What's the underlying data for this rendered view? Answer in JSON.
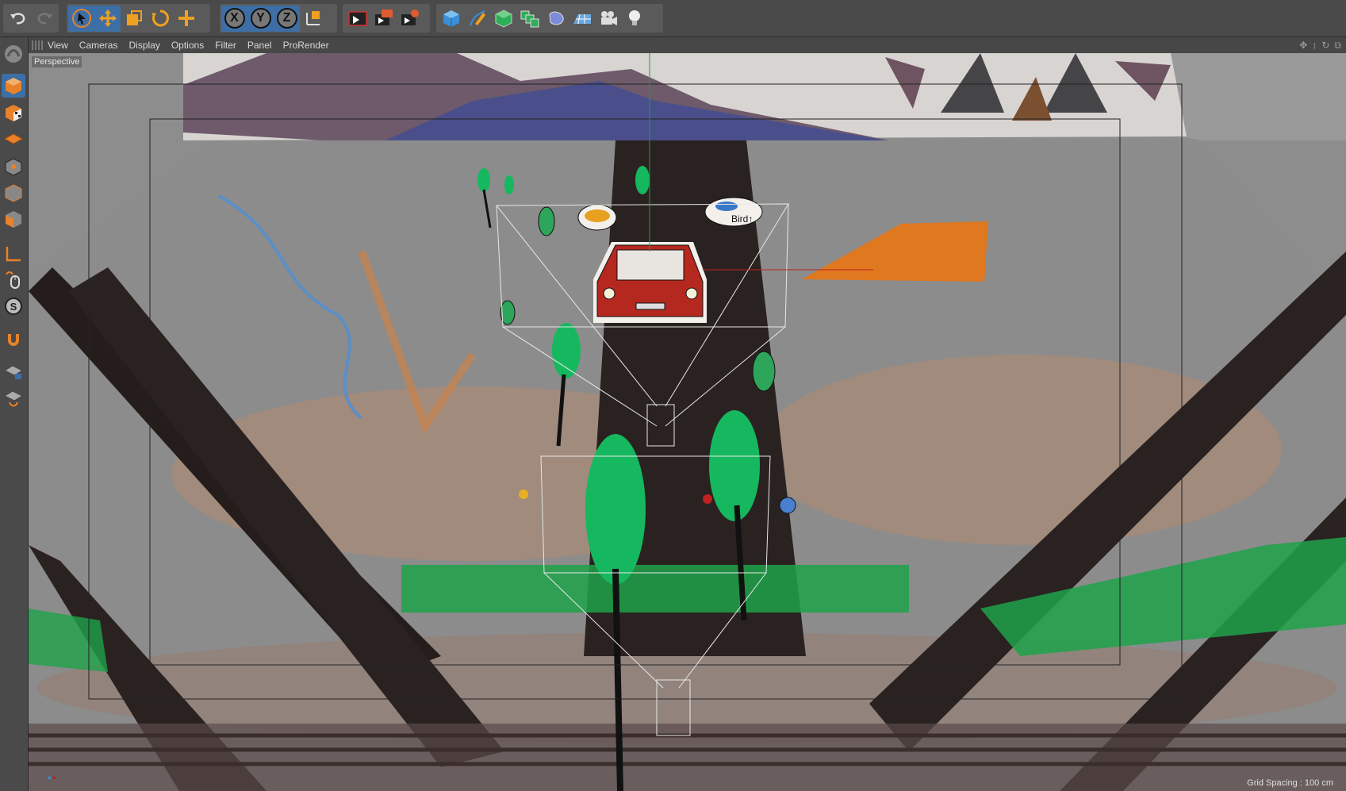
{
  "toolbar": {
    "groups": [
      {
        "name": "history",
        "items": [
          "undo-icon",
          "redo-icon"
        ]
      },
      {
        "name": "tools",
        "items": [
          "select-arrow-icon",
          "move-icon",
          "scale-icon",
          "rotate-icon",
          "last-tool-icon"
        ]
      },
      {
        "name": "axis-lock",
        "items": [
          "X",
          "Y",
          "Z",
          "coordinate-system-icon"
        ]
      },
      {
        "name": "render",
        "items": [
          "render-view-icon",
          "render-picture-viewer-icon",
          "render-settings-icon"
        ]
      },
      {
        "name": "objects",
        "items": [
          "cube-icon",
          "pen-spline-icon",
          "subdivision-icon",
          "array-icon",
          "deformer-icon",
          "floor-icon",
          "camera-icon",
          "light-icon"
        ]
      }
    ],
    "axis_labels": {
      "x": "X",
      "y": "Y",
      "z": "Z"
    }
  },
  "left_palette": {
    "items": [
      "make-editable-icon",
      "model-mode-icon",
      "texture-mode-icon",
      "workplane-icon",
      "points-mode-icon",
      "edges-mode-icon",
      "polygons-mode-icon",
      "axis-mode-icon",
      "tweak-mode-icon",
      "solo-icon",
      "snap-icon",
      "workplane-lock-icon",
      "workplane-snap-icon"
    ]
  },
  "viewport_menu": {
    "items": [
      "View",
      "Cameras",
      "Display",
      "Options",
      "Filter",
      "Panel",
      "ProRender"
    ]
  },
  "viewport": {
    "label": "Perspective",
    "grid_spacing": "Grid Spacing : 100 cm"
  },
  "scene_text": {
    "bird_label": "Bird↑"
  },
  "colors": {
    "accent": "#3d6fa6",
    "bg": "#4a4a4a",
    "road": "#2a2220",
    "grass": "#1fa24a",
    "tree": "#16b85f",
    "car": "#b5281f",
    "tent": "#e07820"
  }
}
